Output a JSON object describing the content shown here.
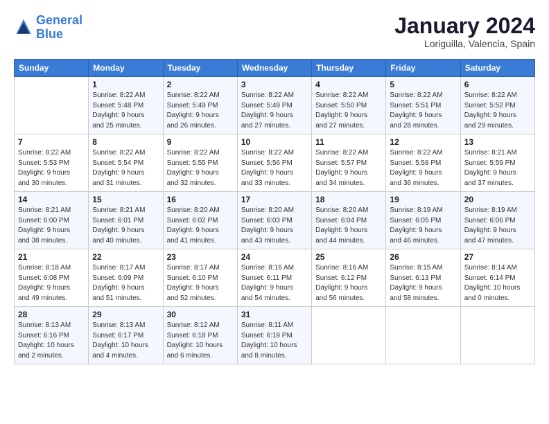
{
  "header": {
    "logo_line1": "General",
    "logo_line2": "Blue",
    "title": "January 2024",
    "subtitle": "Loriguilla, Valencia, Spain"
  },
  "calendar": {
    "weekdays": [
      "Sunday",
      "Monday",
      "Tuesday",
      "Wednesday",
      "Thursday",
      "Friday",
      "Saturday"
    ],
    "weeks": [
      [
        {
          "day": "",
          "detail": ""
        },
        {
          "day": "1",
          "detail": "Sunrise: 8:22 AM\nSunset: 5:48 PM\nDaylight: 9 hours\nand 25 minutes."
        },
        {
          "day": "2",
          "detail": "Sunrise: 8:22 AM\nSunset: 5:49 PM\nDaylight: 9 hours\nand 26 minutes."
        },
        {
          "day": "3",
          "detail": "Sunrise: 8:22 AM\nSunset: 5:49 PM\nDaylight: 9 hours\nand 27 minutes."
        },
        {
          "day": "4",
          "detail": "Sunrise: 8:22 AM\nSunset: 5:50 PM\nDaylight: 9 hours\nand 27 minutes."
        },
        {
          "day": "5",
          "detail": "Sunrise: 8:22 AM\nSunset: 5:51 PM\nDaylight: 9 hours\nand 28 minutes."
        },
        {
          "day": "6",
          "detail": "Sunrise: 8:22 AM\nSunset: 5:52 PM\nDaylight: 9 hours\nand 29 minutes."
        }
      ],
      [
        {
          "day": "7",
          "detail": "Sunrise: 8:22 AM\nSunset: 5:53 PM\nDaylight: 9 hours\nand 30 minutes."
        },
        {
          "day": "8",
          "detail": "Sunrise: 8:22 AM\nSunset: 5:54 PM\nDaylight: 9 hours\nand 31 minutes."
        },
        {
          "day": "9",
          "detail": "Sunrise: 8:22 AM\nSunset: 5:55 PM\nDaylight: 9 hours\nand 32 minutes."
        },
        {
          "day": "10",
          "detail": "Sunrise: 8:22 AM\nSunset: 5:56 PM\nDaylight: 9 hours\nand 33 minutes."
        },
        {
          "day": "11",
          "detail": "Sunrise: 8:22 AM\nSunset: 5:57 PM\nDaylight: 9 hours\nand 34 minutes."
        },
        {
          "day": "12",
          "detail": "Sunrise: 8:22 AM\nSunset: 5:58 PM\nDaylight: 9 hours\nand 36 minutes."
        },
        {
          "day": "13",
          "detail": "Sunrise: 8:21 AM\nSunset: 5:59 PM\nDaylight: 9 hours\nand 37 minutes."
        }
      ],
      [
        {
          "day": "14",
          "detail": "Sunrise: 8:21 AM\nSunset: 6:00 PM\nDaylight: 9 hours\nand 38 minutes."
        },
        {
          "day": "15",
          "detail": "Sunrise: 8:21 AM\nSunset: 6:01 PM\nDaylight: 9 hours\nand 40 minutes."
        },
        {
          "day": "16",
          "detail": "Sunrise: 8:20 AM\nSunset: 6:02 PM\nDaylight: 9 hours\nand 41 minutes."
        },
        {
          "day": "17",
          "detail": "Sunrise: 8:20 AM\nSunset: 6:03 PM\nDaylight: 9 hours\nand 43 minutes."
        },
        {
          "day": "18",
          "detail": "Sunrise: 8:20 AM\nSunset: 6:04 PM\nDaylight: 9 hours\nand 44 minutes."
        },
        {
          "day": "19",
          "detail": "Sunrise: 8:19 AM\nSunset: 6:05 PM\nDaylight: 9 hours\nand 46 minutes."
        },
        {
          "day": "20",
          "detail": "Sunrise: 8:19 AM\nSunset: 6:06 PM\nDaylight: 9 hours\nand 47 minutes."
        }
      ],
      [
        {
          "day": "21",
          "detail": "Sunrise: 8:18 AM\nSunset: 6:08 PM\nDaylight: 9 hours\nand 49 minutes."
        },
        {
          "day": "22",
          "detail": "Sunrise: 8:17 AM\nSunset: 6:09 PM\nDaylight: 9 hours\nand 51 minutes."
        },
        {
          "day": "23",
          "detail": "Sunrise: 8:17 AM\nSunset: 6:10 PM\nDaylight: 9 hours\nand 52 minutes."
        },
        {
          "day": "24",
          "detail": "Sunrise: 8:16 AM\nSunset: 6:11 PM\nDaylight: 9 hours\nand 54 minutes."
        },
        {
          "day": "25",
          "detail": "Sunrise: 8:16 AM\nSunset: 6:12 PM\nDaylight: 9 hours\nand 56 minutes."
        },
        {
          "day": "26",
          "detail": "Sunrise: 8:15 AM\nSunset: 6:13 PM\nDaylight: 9 hours\nand 58 minutes."
        },
        {
          "day": "27",
          "detail": "Sunrise: 8:14 AM\nSunset: 6:14 PM\nDaylight: 10 hours\nand 0 minutes."
        }
      ],
      [
        {
          "day": "28",
          "detail": "Sunrise: 8:13 AM\nSunset: 6:16 PM\nDaylight: 10 hours\nand 2 minutes."
        },
        {
          "day": "29",
          "detail": "Sunrise: 8:13 AM\nSunset: 6:17 PM\nDaylight: 10 hours\nand 4 minutes."
        },
        {
          "day": "30",
          "detail": "Sunrise: 8:12 AM\nSunset: 6:18 PM\nDaylight: 10 hours\nand 6 minutes."
        },
        {
          "day": "31",
          "detail": "Sunrise: 8:11 AM\nSunset: 6:19 PM\nDaylight: 10 hours\nand 8 minutes."
        },
        {
          "day": "",
          "detail": ""
        },
        {
          "day": "",
          "detail": ""
        },
        {
          "day": "",
          "detail": ""
        }
      ]
    ]
  }
}
